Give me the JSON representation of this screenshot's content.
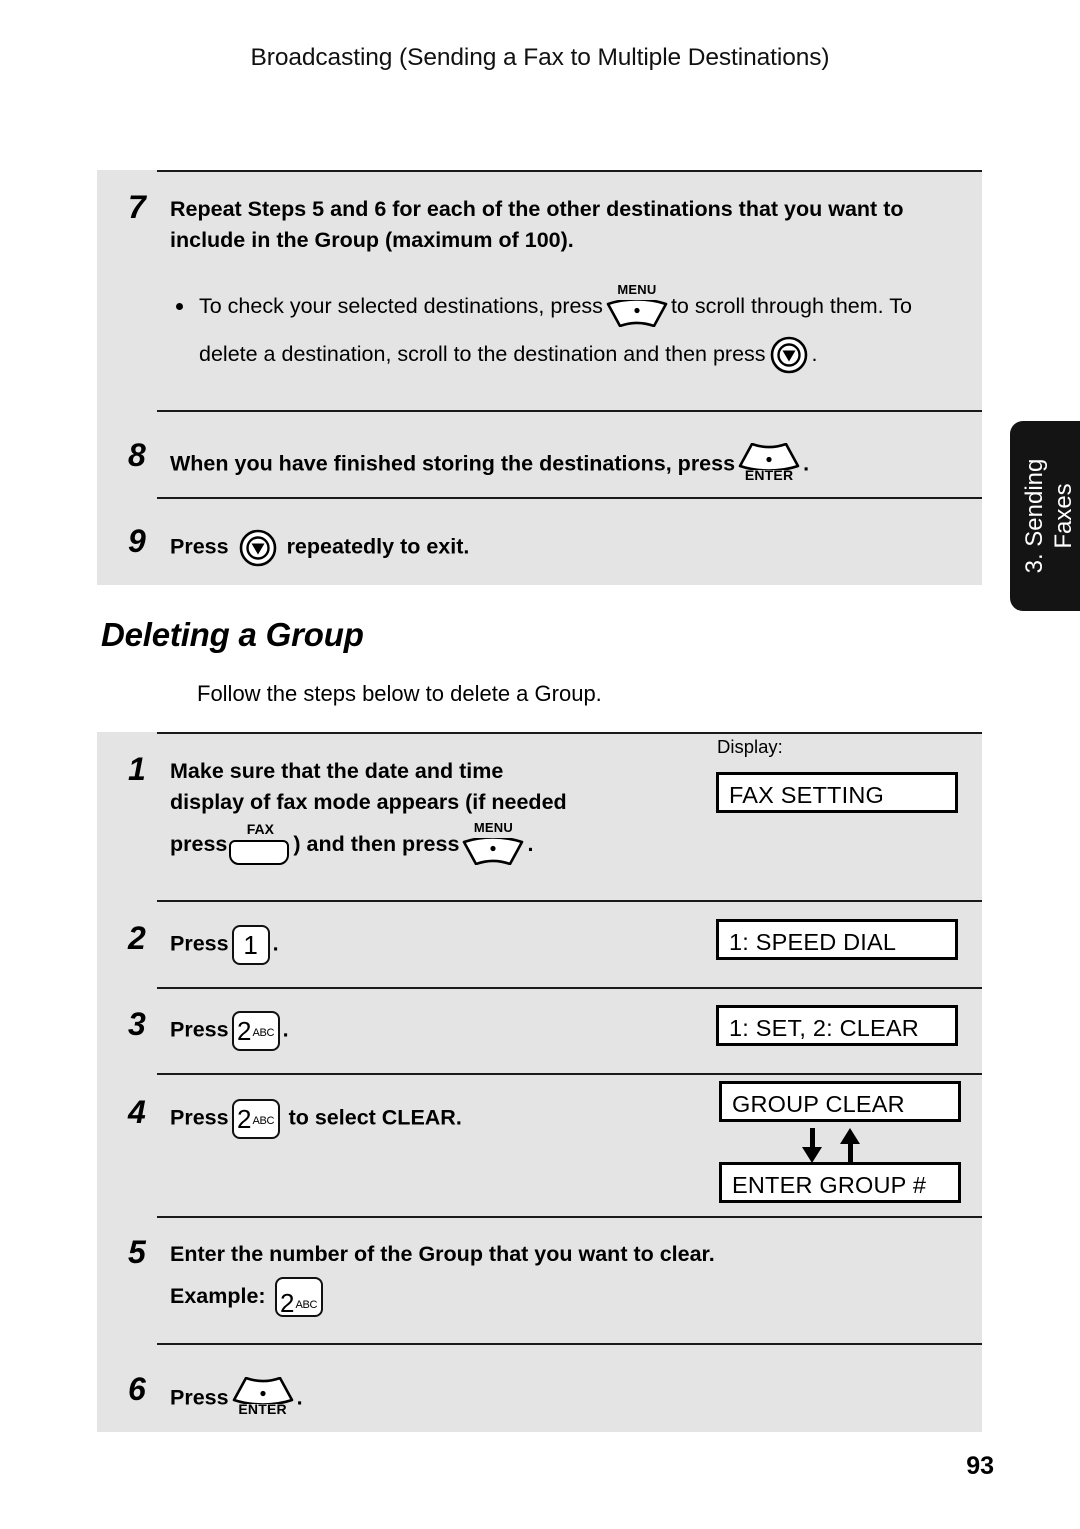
{
  "header": {
    "running_title": "Broadcasting (Sending a Fax to Multiple Destinations)"
  },
  "side_tab": {
    "line1": "3. Sending",
    "line2": "Faxes"
  },
  "page_number": "93",
  "top_panel": {
    "steps": [
      {
        "number": "7",
        "line1": "Repeat Steps 5 and 6 for each of the other destinations that you want to",
        "line2": "include in the Group (maximum of 100).",
        "bullet": {
          "part1": "To check your selected destinations, press",
          "key1": {
            "name": "menu-key",
            "label": "MENU"
          },
          "part2": "to scroll through them. To",
          "part3": "delete a destination, scroll to the destination and then press",
          "key2": {
            "name": "stop-key",
            "label": ""
          },
          "part4": "."
        }
      },
      {
        "number": "8",
        "text": "When you have finished storing the destinations, press",
        "key": {
          "name": "enter-key",
          "label": "ENTER"
        },
        "tail": "."
      },
      {
        "number": "9",
        "text_before": "Press",
        "key": {
          "name": "stop-key",
          "label": ""
        },
        "text_after": "repeatedly to exit."
      }
    ]
  },
  "section": {
    "heading": "Deleting a Group",
    "intro": "Follow the steps below to delete a Group."
  },
  "bottom_panel": {
    "display_label": "Display:",
    "steps": [
      {
        "number": "1",
        "line1": "Make sure that the date and time",
        "line2": "display of fax mode appears (if needed",
        "line3_a": "press",
        "key_fax": {
          "name": "fax-key",
          "label": "FAX"
        },
        "line3_b": ") and then press",
        "key_menu": {
          "name": "menu-key",
          "label": "MENU"
        },
        "line3_c": ".",
        "display": "FAX SETTING"
      },
      {
        "number": "2",
        "text_before": "Press",
        "key": {
          "name": "keypad-1",
          "digit": "1",
          "sub": ""
        },
        "text_after": ".",
        "display": "1: SPEED DIAL"
      },
      {
        "number": "3",
        "text_before": "Press",
        "key": {
          "name": "keypad-2",
          "digit": "2",
          "sub": "ABC"
        },
        "text_after": ".",
        "display": "1: SET, 2: CLEAR"
      },
      {
        "number": "4",
        "text_before": "Press",
        "key": {
          "name": "keypad-2",
          "digit": "2",
          "sub": "ABC"
        },
        "text_after": "to select CLEAR.",
        "display_top": "GROUP CLEAR",
        "display_bottom": "ENTER GROUP #"
      },
      {
        "number": "5",
        "line1": "Enter the number of the Group that you want to clear.",
        "example_label": "Example:",
        "key": {
          "name": "keypad-2",
          "digit": "2",
          "sub": "ABC"
        }
      },
      {
        "number": "6",
        "text_before": "Press",
        "key": {
          "name": "enter-key",
          "label": "ENTER"
        },
        "text_after": "."
      }
    ]
  },
  "colors": {
    "panel_background": "#e4e4e4",
    "page_background": "#ffffff",
    "rule": "#1a1a1a",
    "side_tab_background": "#141414",
    "side_tab_text": "#ffffff"
  }
}
